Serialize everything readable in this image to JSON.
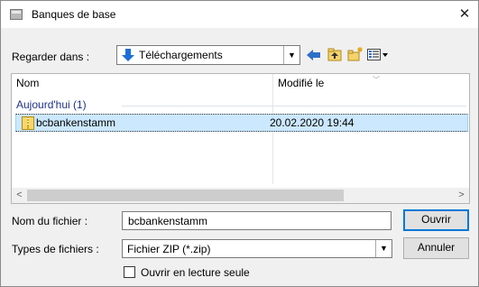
{
  "window": {
    "title": "Banques de base",
    "close_glyph": "✕"
  },
  "toolbar": {
    "look_in_label": "Regarder dans :",
    "look_in_value": "Téléchargements",
    "back_icon": "⇦",
    "up_icon": "up-folder-icon",
    "new_folder_icon": "new-folder-icon",
    "view_icon": "view-menu-icon"
  },
  "list": {
    "columns": [
      {
        "label": "Nom"
      },
      {
        "label": "Modifié le"
      }
    ],
    "group_header": "Aujourd'hui (1)",
    "rows": [
      {
        "name": "bcbankenstamm",
        "modified": "20.02.2020 19:44",
        "selected": true
      }
    ]
  },
  "form": {
    "filename_label": "Nom du fichier :",
    "filename_value": "bcbankenstamm",
    "filetype_label": "Types de fichiers :",
    "filetype_value": "Fichier ZIP (*.zip)",
    "open_button": "Ouvrir",
    "cancel_button": "Annuler",
    "readonly_label": "Ouvrir en lecture seule",
    "readonly_checked": false
  },
  "colors": {
    "selection_bg": "#cce8ff",
    "group_header": "#1e3287",
    "default_button_border": "#0078d7"
  }
}
